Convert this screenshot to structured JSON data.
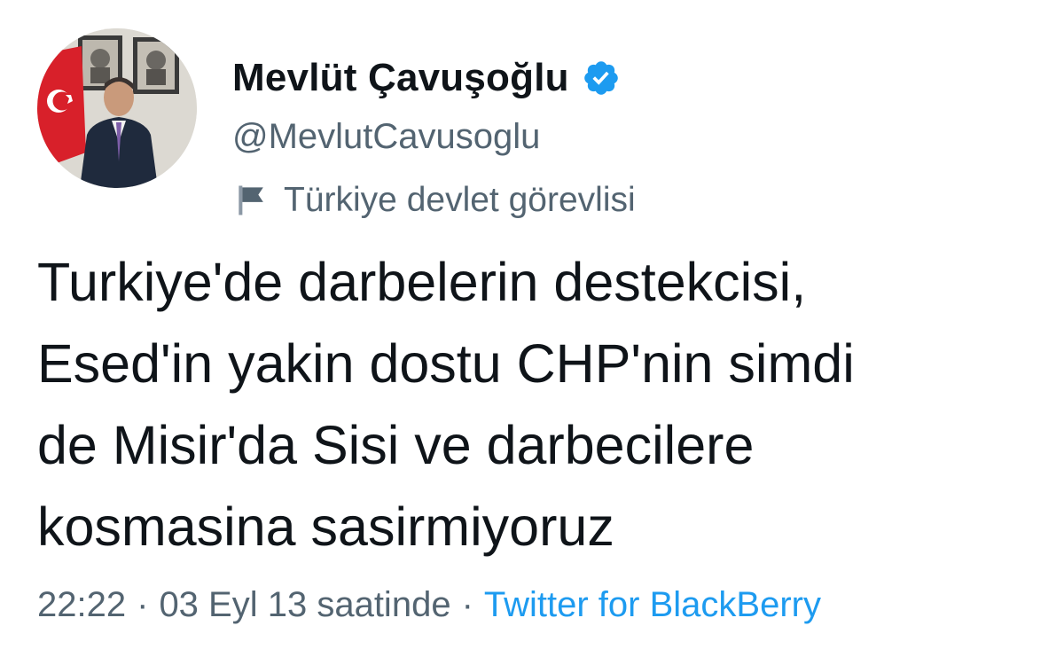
{
  "user": {
    "display_name": "Mevlüt Çavuşoğlu",
    "handle": "@MevlutCavusoglu",
    "label": "Türkiye devlet görevlisi",
    "verified_color": "#1d9bf0"
  },
  "tweet": {
    "lines": [
      "Turkiye'de darbelerin destekcisi,",
      "Esed'in yakin dostu CHP'nin simdi",
      "de Misir'da Sisi ve darbecilere",
      "kosmasina sasirmiyoruz"
    ]
  },
  "meta": {
    "time": "22:22",
    "separator": "·",
    "date": "03 Eyl 13 saatinde",
    "source": "Twitter for BlackBerry"
  },
  "icons": {
    "verified": "verified-badge-icon",
    "label": "flag-icon"
  },
  "colors": {
    "text": "#0f1419",
    "secondary": "#536471",
    "link": "#1d9bf0"
  }
}
